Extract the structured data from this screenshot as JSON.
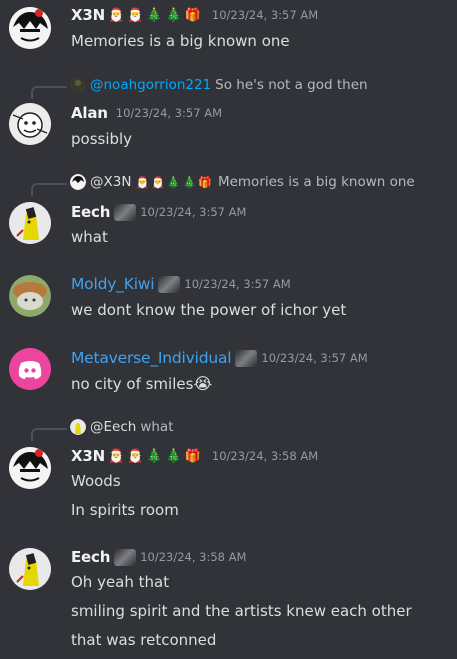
{
  "messages": [
    {
      "author": "X3N",
      "badges": [
        "🎅",
        "🎅",
        "🎄",
        "🎄",
        "🎁"
      ],
      "timestamp": "10/23/24, 3:57 AM",
      "lines": [
        "Memories is a big known one"
      ]
    },
    {
      "reply": {
        "mention": "@noahgorrion221",
        "text": "So he's not a god then"
      },
      "author": "Alan",
      "timestamp": "10/23/24, 3:57 AM",
      "lines": [
        "possibly"
      ]
    },
    {
      "reply": {
        "name": "@X3N",
        "badges": [
          "🎅",
          "🎅",
          "🎄",
          "🎄",
          "🎁"
        ],
        "text": "Memories is a big known one"
      },
      "author": "Eech",
      "timestamp": "10/23/24, 3:57 AM",
      "lines": [
        "what"
      ]
    },
    {
      "author": "Moldy_Kiwi",
      "timestamp": "10/23/24, 3:57 AM",
      "lines": [
        "we dont know the power of ichor yet"
      ]
    },
    {
      "author": "Metaverse_Individual",
      "timestamp": "10/23/24, 3:57 AM",
      "lines": [
        "no city of smiles"
      ],
      "emoji": "😭"
    },
    {
      "reply": {
        "name": "@Eech",
        "text": "what"
      },
      "author": "X3N",
      "badges": [
        "🎅",
        "🎅",
        "🎄",
        "🎄",
        "🎁"
      ],
      "timestamp": "10/23/24, 3:58 AM",
      "lines": [
        "Woods",
        "In spirits room"
      ]
    },
    {
      "author": "Eech",
      "timestamp": "10/23/24, 3:58 AM",
      "lines": [
        "Oh yeah that",
        "smiling spirit and the artists knew each other",
        "that was retconned"
      ]
    }
  ],
  "colors": {
    "background": "#313338",
    "text": "#dbdee1",
    "timestamp": "#949ba4",
    "mention": "#00a8fc",
    "role_blue": "#3ea3f2",
    "discord_default_avatar": "#eb459e"
  }
}
